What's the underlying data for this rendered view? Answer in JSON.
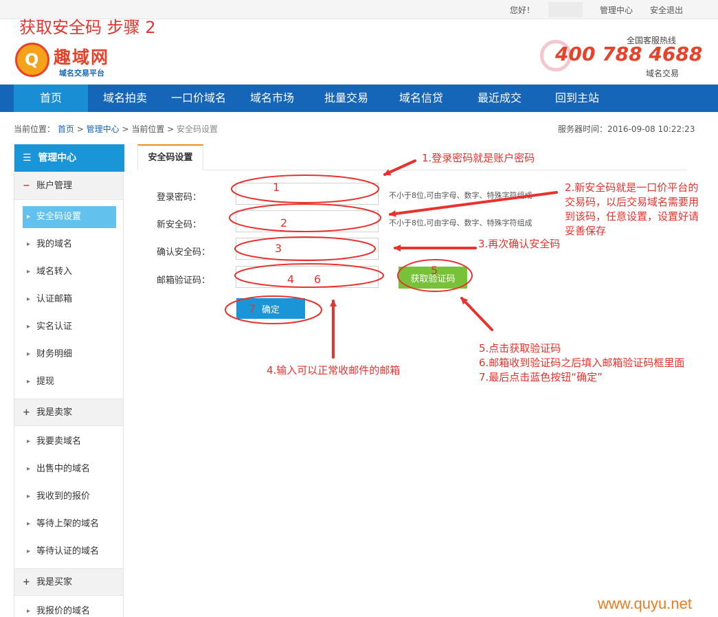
{
  "topbar": {
    "greeting": "您好！",
    "admin_link": "管理中心",
    "logout_link": "安全退出"
  },
  "step_title": "获取安全码 步骤 2",
  "logo": {
    "name": "趣域网",
    "tagline": "域名交易平台"
  },
  "hotline": {
    "label": "全国客服热线",
    "number": "400 788 4688",
    "sub": "域名交易"
  },
  "nav": [
    "首页",
    "域名拍卖",
    "一口价域名",
    "域名市场",
    "批量交易",
    "域名信贷",
    "最近成交",
    "回到主站"
  ],
  "breadcrumb": {
    "prefix": "当前位置：",
    "home": "首页",
    "admin": "管理中心",
    "current": "当前位置",
    "page": "安全码设置",
    "separator": ">"
  },
  "server_time": "服务器时间：2016-09-08 10:22:23",
  "sidebar": {
    "title": "管理中心",
    "groups": [
      {
        "label": "账户管理",
        "sign": "−",
        "items": [
          "安全码设置",
          "我的域名",
          "域名转入",
          "认证邮箱",
          "实名认证",
          "财务明细",
          "提现"
        ]
      },
      {
        "label": "我是卖家",
        "sign": "+",
        "items": [
          "我要卖域名",
          "出售中的域名",
          "我收到的报价",
          "等待上架的域名",
          "等待认证的域名"
        ]
      },
      {
        "label": "我是买家",
        "sign": "+",
        "items": [
          "我报价的域名"
        ]
      }
    ]
  },
  "tab": "安全码设置",
  "form": {
    "login_password_label": "登录密码：",
    "new_code_label": "新安全码：",
    "confirm_code_label": "确认安全码：",
    "email_code_label": "邮箱验证码：",
    "hint": "不小于8位,可由字母、数字、特殊字符组成",
    "get_code_button": "获取验证码",
    "confirm_button": "确定"
  },
  "annotations": {
    "a1": "1.登录密码就是账户密码",
    "a2": [
      "2.新安全码就是一口价平台的",
      "交易码，以后交易域名需要用",
      "到该码，任意设置，设置好请",
      "妥善保存"
    ],
    "a3": "3.再次确认安全码",
    "a4": "4.输入可以正常收邮件的邮箱",
    "a5": [
      "5.点击获取验证码",
      "6.邮箱收到验证码之后填入邮箱验证码框里面",
      "7.最后点击蓝色按钮“确定”"
    ],
    "n1": "1",
    "n2": "2",
    "n3": "3",
    "n4": "4",
    "n5": "5",
    "n6": "6",
    "n7": "7"
  },
  "colors": {
    "nav": "#1565b8",
    "nav_active": "#1a8ed4",
    "sidebar_head": "#1a96d8",
    "annotation": "#e8322e",
    "code_button": "#78c23a"
  },
  "watermark": "www.quyu.net"
}
